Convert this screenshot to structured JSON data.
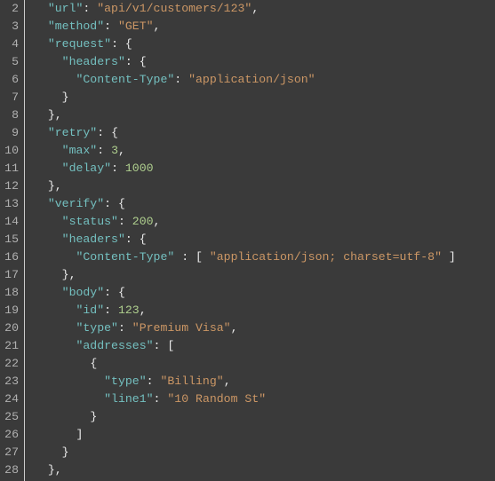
{
  "lines": [
    {
      "num": 2,
      "indent": 1,
      "parts": [
        {
          "t": "key",
          "v": "\"url\""
        },
        {
          "t": "punc",
          "v": ": "
        },
        {
          "t": "str",
          "v": "\"api/v1/customers/123\""
        },
        {
          "t": "punc",
          "v": ","
        }
      ]
    },
    {
      "num": 3,
      "indent": 1,
      "parts": [
        {
          "t": "key",
          "v": "\"method\""
        },
        {
          "t": "punc",
          "v": ": "
        },
        {
          "t": "str",
          "v": "\"GET\""
        },
        {
          "t": "punc",
          "v": ","
        }
      ]
    },
    {
      "num": 4,
      "indent": 1,
      "parts": [
        {
          "t": "key",
          "v": "\"request\""
        },
        {
          "t": "punc",
          "v": ": "
        },
        {
          "t": "bracket",
          "v": "{"
        }
      ]
    },
    {
      "num": 5,
      "indent": 2,
      "parts": [
        {
          "t": "key",
          "v": "\"headers\""
        },
        {
          "t": "punc",
          "v": ": "
        },
        {
          "t": "bracket",
          "v": "{"
        }
      ]
    },
    {
      "num": 6,
      "indent": 3,
      "parts": [
        {
          "t": "key",
          "v": "\"Content-Type\""
        },
        {
          "t": "punc",
          "v": ": "
        },
        {
          "t": "str",
          "v": "\"application/json\""
        }
      ]
    },
    {
      "num": 7,
      "indent": 2,
      "parts": [
        {
          "t": "bracket",
          "v": "}"
        }
      ]
    },
    {
      "num": 8,
      "indent": 1,
      "parts": [
        {
          "t": "bracket",
          "v": "}"
        },
        {
          "t": "punc",
          "v": ","
        }
      ]
    },
    {
      "num": 9,
      "indent": 1,
      "parts": [
        {
          "t": "key",
          "v": "\"retry\""
        },
        {
          "t": "punc",
          "v": ": "
        },
        {
          "t": "bracket",
          "v": "{"
        }
      ]
    },
    {
      "num": 10,
      "indent": 2,
      "parts": [
        {
          "t": "key",
          "v": "\"max\""
        },
        {
          "t": "punc",
          "v": ": "
        },
        {
          "t": "num",
          "v": "3"
        },
        {
          "t": "punc",
          "v": ","
        }
      ]
    },
    {
      "num": 11,
      "indent": 2,
      "parts": [
        {
          "t": "key",
          "v": "\"delay\""
        },
        {
          "t": "punc",
          "v": ": "
        },
        {
          "t": "num",
          "v": "1000"
        }
      ]
    },
    {
      "num": 12,
      "indent": 1,
      "parts": [
        {
          "t": "bracket",
          "v": "}"
        },
        {
          "t": "punc",
          "v": ","
        }
      ]
    },
    {
      "num": 13,
      "indent": 1,
      "parts": [
        {
          "t": "key",
          "v": "\"verify\""
        },
        {
          "t": "punc",
          "v": ": "
        },
        {
          "t": "bracket",
          "v": "{"
        }
      ]
    },
    {
      "num": 14,
      "indent": 2,
      "parts": [
        {
          "t": "key",
          "v": "\"status\""
        },
        {
          "t": "punc",
          "v": ": "
        },
        {
          "t": "num",
          "v": "200"
        },
        {
          "t": "punc",
          "v": ","
        }
      ]
    },
    {
      "num": 15,
      "indent": 2,
      "parts": [
        {
          "t": "key",
          "v": "\"headers\""
        },
        {
          "t": "punc",
          "v": ": "
        },
        {
          "t": "bracket",
          "v": "{"
        }
      ]
    },
    {
      "num": 16,
      "indent": 3,
      "parts": [
        {
          "t": "key",
          "v": "\"Content-Type\""
        },
        {
          "t": "punc",
          "v": " : "
        },
        {
          "t": "bracket",
          "v": "[ "
        },
        {
          "t": "str",
          "v": "\"application/json; charset=utf-8\""
        },
        {
          "t": "bracket",
          "v": " ]"
        }
      ]
    },
    {
      "num": 17,
      "indent": 2,
      "parts": [
        {
          "t": "bracket",
          "v": "}"
        },
        {
          "t": "punc",
          "v": ","
        }
      ]
    },
    {
      "num": 18,
      "indent": 2,
      "parts": [
        {
          "t": "key",
          "v": "\"body\""
        },
        {
          "t": "punc",
          "v": ": "
        },
        {
          "t": "bracket",
          "v": "{"
        }
      ]
    },
    {
      "num": 19,
      "indent": 3,
      "parts": [
        {
          "t": "key",
          "v": "\"id\""
        },
        {
          "t": "punc",
          "v": ": "
        },
        {
          "t": "num",
          "v": "123"
        },
        {
          "t": "punc",
          "v": ","
        }
      ]
    },
    {
      "num": 20,
      "indent": 3,
      "parts": [
        {
          "t": "key",
          "v": "\"type\""
        },
        {
          "t": "punc",
          "v": ": "
        },
        {
          "t": "str",
          "v": "\"Premium Visa\""
        },
        {
          "t": "punc",
          "v": ","
        }
      ]
    },
    {
      "num": 21,
      "indent": 3,
      "parts": [
        {
          "t": "key",
          "v": "\"addresses\""
        },
        {
          "t": "punc",
          "v": ": "
        },
        {
          "t": "bracket",
          "v": "["
        }
      ]
    },
    {
      "num": 22,
      "indent": 4,
      "parts": [
        {
          "t": "bracket",
          "v": "{"
        }
      ]
    },
    {
      "num": 23,
      "indent": 5,
      "parts": [
        {
          "t": "key",
          "v": "\"type\""
        },
        {
          "t": "punc",
          "v": ": "
        },
        {
          "t": "str",
          "v": "\"Billing\""
        },
        {
          "t": "punc",
          "v": ","
        }
      ]
    },
    {
      "num": 24,
      "indent": 5,
      "parts": [
        {
          "t": "key",
          "v": "\"line1\""
        },
        {
          "t": "punc",
          "v": ": "
        },
        {
          "t": "str",
          "v": "\"10 Random St\""
        }
      ]
    },
    {
      "num": 25,
      "indent": 4,
      "parts": [
        {
          "t": "bracket",
          "v": "}"
        }
      ]
    },
    {
      "num": 26,
      "indent": 3,
      "parts": [
        {
          "t": "bracket",
          "v": "]"
        }
      ]
    },
    {
      "num": 27,
      "indent": 2,
      "parts": [
        {
          "t": "bracket",
          "v": "}"
        }
      ]
    },
    {
      "num": 28,
      "indent": 1,
      "parts": [
        {
          "t": "bracket",
          "v": "}"
        },
        {
          "t": "punc",
          "v": ","
        }
      ]
    }
  ],
  "indent_unit": "  "
}
